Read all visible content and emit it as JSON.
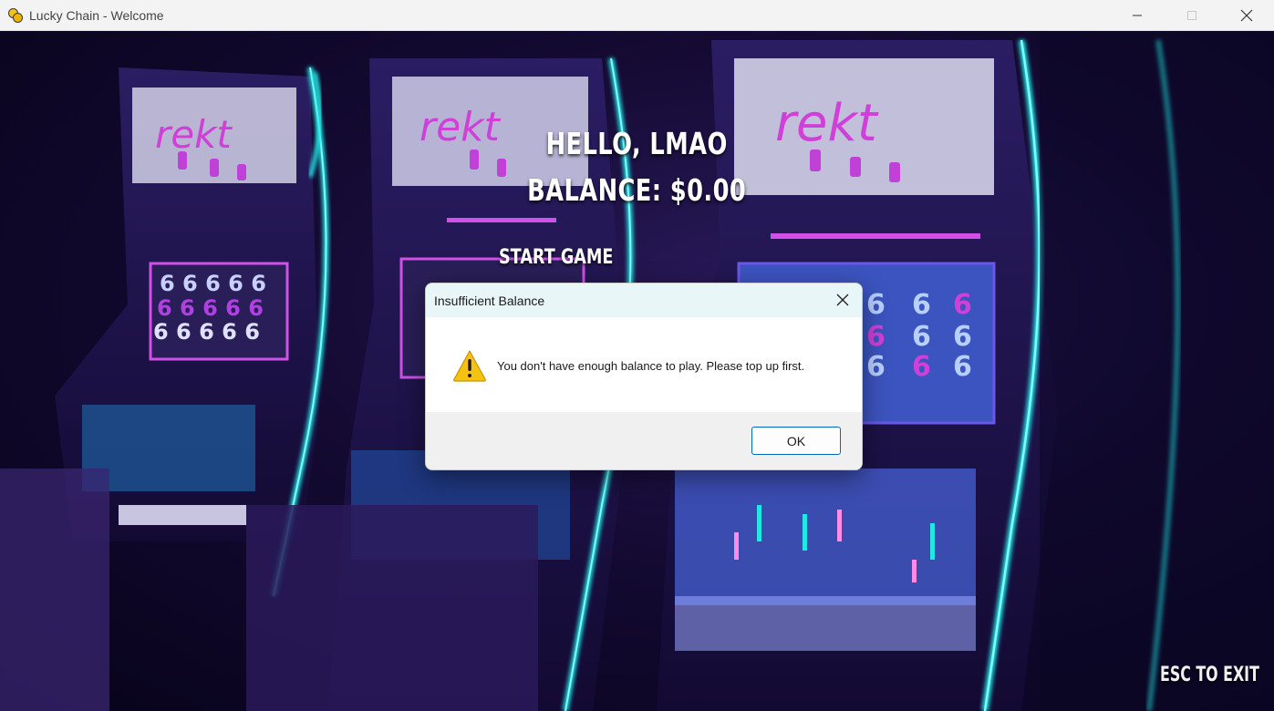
{
  "window": {
    "title": "Lucky Chain - Welcome",
    "app_icon": "pygame-icon"
  },
  "game": {
    "greeting": "HELLO, LMAO",
    "balance": "BALANCE: $0.00",
    "start_label": "START GAME",
    "exit_hint": "ESC TO EXIT",
    "machine_sign": "rekt"
  },
  "dialog": {
    "title": "Insufficient Balance",
    "icon": "warning-icon",
    "message": "You don't have enough balance to play. Please top up first.",
    "ok_label": "OK"
  },
  "colors": {
    "neon_cyan": "#22e6e6",
    "neon_magenta": "#d84ae8",
    "neon_blue": "#4a6cf0",
    "ok_border": "#0067c0",
    "dialog_title_bg": "#e9f6f7"
  }
}
